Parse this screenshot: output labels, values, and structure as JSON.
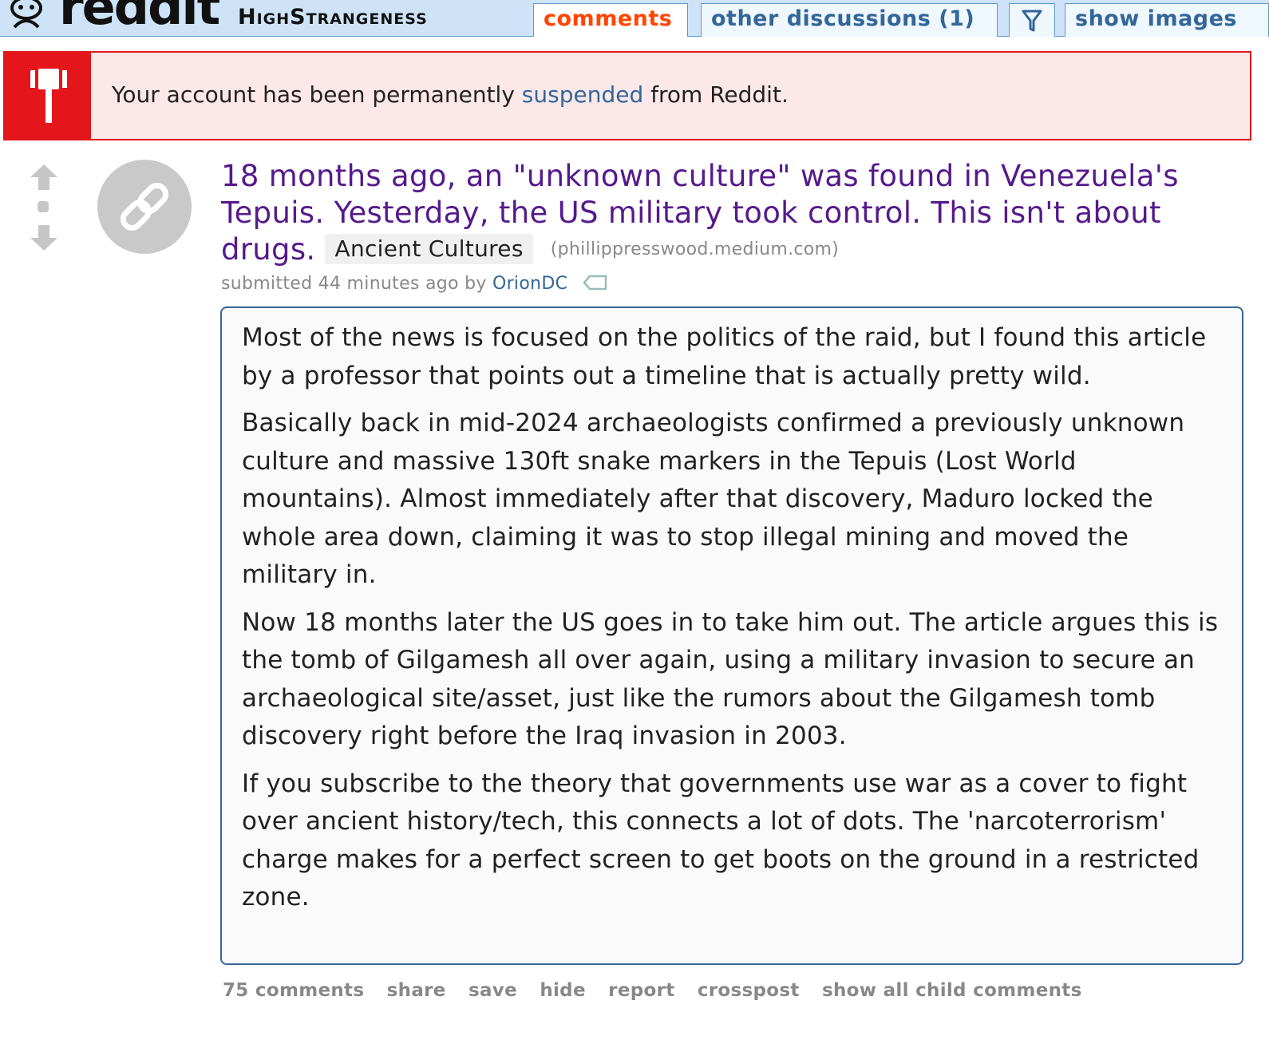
{
  "header": {
    "logo_text": "reddit",
    "subreddit": "HighStrangeness",
    "tabs": {
      "comments": "comments",
      "other_discussions": "other discussions (1)",
      "show_images": "show images"
    }
  },
  "banner": {
    "text_before": "Your account has been permanently ",
    "link": "suspended",
    "text_after": " from Reddit."
  },
  "post": {
    "title": "18 months ago, an \"unknown culture\" was found in Venezuela's Tepuis. Yesterday, the US military took control. This isn't about drugs.",
    "flair": "Ancient Cultures",
    "domain": "(phillippresswood.medium.com)",
    "tagline_prefix": "submitted 44 minutes ago by ",
    "author": "OrionDC",
    "body": [
      "Most of the news is focused on the politics of the raid, but I found this article by a professor that points out a timeline that is actually pretty wild.",
      "Basically back in mid-2024 archaeologists confirmed a previously unknown culture and massive 130ft snake markers in the Tepuis (Lost World mountains). Almost immediately after that discovery, Maduro locked the whole area down, claiming it was to stop illegal mining and moved the military in.",
      "Now 18 months later the US goes in to take him out. The article argues this is the tomb of Gilgamesh all over again, using a military invasion to secure an archaeological site/asset, just like the rumors about the Gilgamesh tomb discovery right before the Iraq invasion in 2003.",
      "If you subscribe to the theory that governments use war as a cover to fight over ancient history/tech, this connects a lot of dots. The 'narcoterrorism' charge makes for a perfect screen to get boots on the ground in a restricted zone."
    ],
    "buttons": {
      "comments": "75 comments",
      "share": "share",
      "save": "save",
      "hide": "hide",
      "report": "report",
      "crosspost": "crosspost",
      "show_child": "show all child comments"
    }
  },
  "icons": [
    "reddit-alien-icon",
    "filter-icon",
    "gavel-icon",
    "upvote-icon",
    "downvote-icon",
    "link-icon",
    "tag-icon"
  ],
  "colors": {
    "header_bg": "#cee3f8",
    "title_visited": "#551a8b",
    "link": "#336699",
    "active_tab": "#ff4500",
    "suspend_red": "#e4151b",
    "banner_bg": "#fce8e8"
  }
}
